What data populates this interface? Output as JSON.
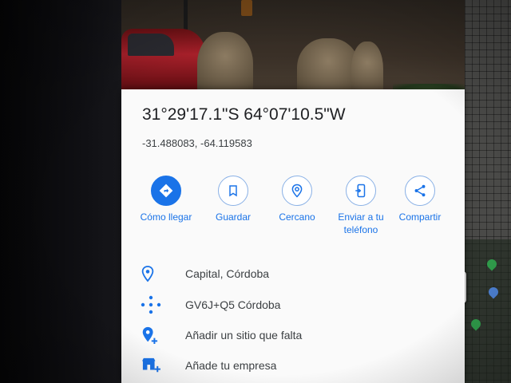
{
  "place": {
    "coordinates_dms": "31°29'17.1\"S 64°07'10.5\"W",
    "coordinates_decimal": "-31.488083, -64.119583"
  },
  "actions": [
    {
      "label": "Cómo llegar",
      "icon": "directions-icon"
    },
    {
      "label": "Guardar",
      "icon": "bookmark-icon"
    },
    {
      "label": "Cercano",
      "icon": "nearby-icon"
    },
    {
      "label": "Enviar a tu teléfono",
      "icon": "phone-send-icon"
    },
    {
      "label": "Compartir",
      "icon": "share-icon"
    }
  ],
  "info_rows": [
    {
      "text": "Capital, Córdoba",
      "icon": "location-pin-icon"
    },
    {
      "text": "GV6J+Q5 Córdoba",
      "icon": "plus-code-icon"
    },
    {
      "text": "Añadir un sitio que falta",
      "icon": "add-place-icon"
    },
    {
      "text": "Añade tu empresa",
      "icon": "add-business-icon"
    }
  ],
  "colors": {
    "accent": "#1a73e8",
    "icon": "#1a73e8",
    "text": "#202124"
  }
}
